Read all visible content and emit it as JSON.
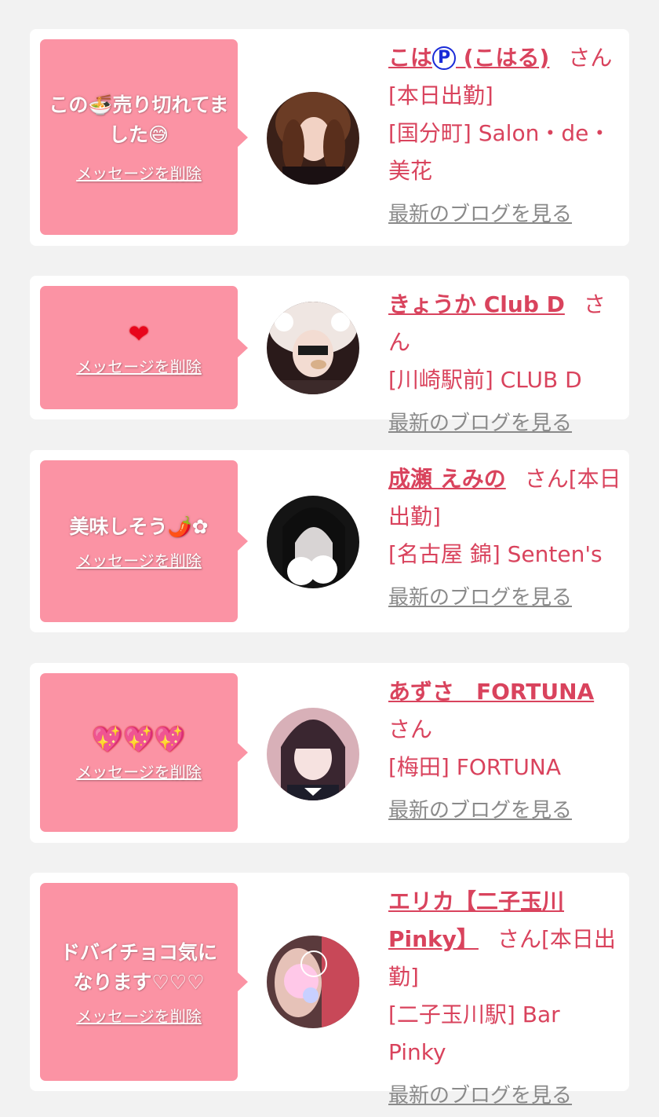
{
  "cards": [
    {
      "message": "この🍜売り切れてました😅",
      "delete_label": "メッセージを削除",
      "name": "こは",
      "name_mark": "P",
      "name_rest": " (こはる)",
      "honorific": "さん",
      "details": [
        "[本日出勤]",
        "[国分町] Salon・de・美花"
      ],
      "blog_label": "最新のブログを見る"
    },
    {
      "message": "❤",
      "delete_label": "メッセージを削除",
      "name": "きょうか Club D",
      "honorific": "さん",
      "details": [
        "[川崎駅前] CLUB D"
      ],
      "blog_label": "最新のブログを見る"
    },
    {
      "message": "美味しそう🌶️✿",
      "delete_label": "メッセージを削除",
      "name": "成瀬 えみの",
      "honorific": "さん[本日出勤]",
      "details": [
        "[名古屋 錦] Senten's"
      ],
      "blog_label": "最新のブログを見る"
    },
    {
      "message": "💖💖💖",
      "delete_label": "メッセージを削除",
      "name": "あずさ　FORTUNA",
      "honorific": "さん",
      "details": [
        "[梅田] FORTUNA"
      ],
      "blog_label": "最新のブログを見る"
    },
    {
      "message": "ドバイチョコ気になります♡♡♡",
      "delete_label": "メッセージを削除",
      "name": "エリカ【二子玉川Pinky】",
      "honorific": "さん[本日出勤]",
      "details": [
        "[二子玉川駅] Bar Pinky"
      ],
      "blog_label": "最新のブログを見る"
    }
  ],
  "colors": {
    "page_bg": "#f2f2f2",
    "bubble": "#fb93a4",
    "accent_text": "#d9435d",
    "link_gray": "#8a8a8a"
  }
}
